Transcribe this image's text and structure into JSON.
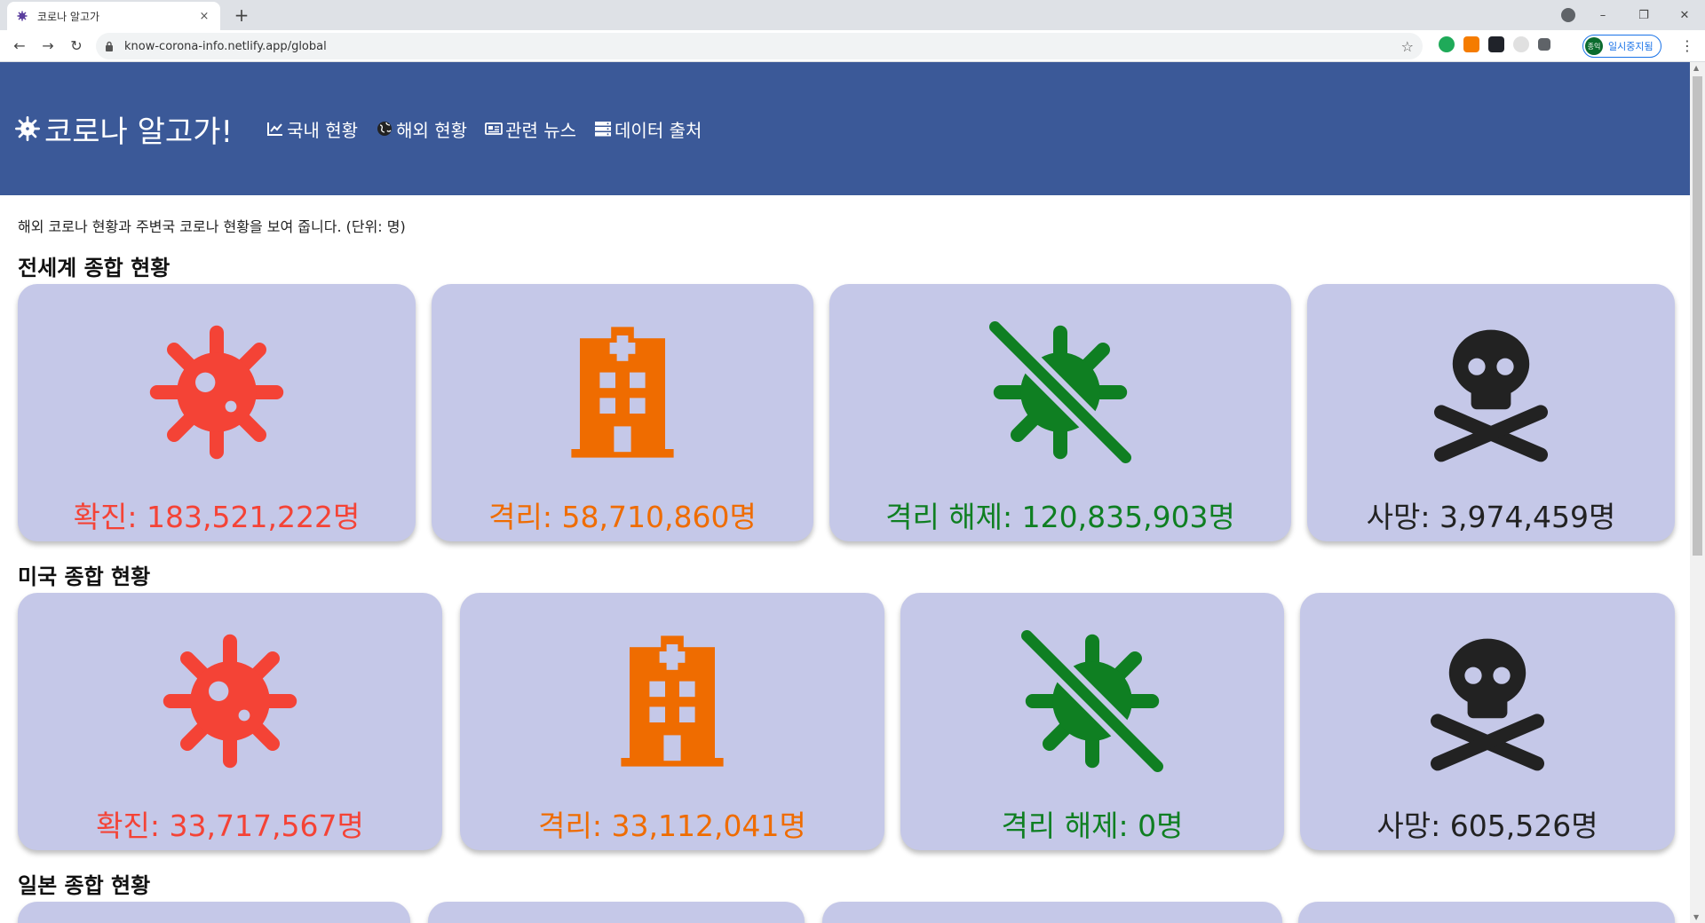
{
  "browser": {
    "tab_title": "코로나 알고가",
    "tab_close": "×",
    "new_tab": "+",
    "url": "know-corona-info.netlify.app/global",
    "paused_label": "일시중지됨",
    "avatar_text": "종익",
    "window_min": "–",
    "window_restore": "❐",
    "window_close": "✕",
    "back": "←",
    "forward": "→",
    "reload": "↻",
    "star": "☆",
    "menu": "⋮"
  },
  "header": {
    "brand": "코로나 알고가!",
    "nav": [
      {
        "label": "국내 현황",
        "icon": "chart-line-icon"
      },
      {
        "label": "해외 현황",
        "icon": "globe-icon"
      },
      {
        "label": "관련 뉴스",
        "icon": "newspaper-icon"
      },
      {
        "label": "데이터 출처",
        "icon": "server-icon"
      }
    ]
  },
  "intro": "해외 코로나 현황과 주변국 코로나 현황을 보여 줍니다. (단위: 명)",
  "sections": [
    {
      "title": "전세계 종합 현황",
      "cards": [
        {
          "label": "확진: 183,521,222명",
          "icon": "virus-icon",
          "color": "#f44336"
        },
        {
          "label": "격리: 58,710,860명",
          "icon": "hospital-icon",
          "color": "#ef6c00"
        },
        {
          "label": "격리 해제: 120,835,903명",
          "icon": "virus-slash-icon",
          "color": "#0f7f22"
        },
        {
          "label": "사망: 3,974,459명",
          "icon": "skull-crossbones-icon",
          "color": "#222222"
        }
      ]
    },
    {
      "title": "미국 종합 현황",
      "cards": [
        {
          "label": "확진: 33,717,567명",
          "icon": "virus-icon",
          "color": "#f44336"
        },
        {
          "label": "격리: 33,112,041명",
          "icon": "hospital-icon",
          "color": "#ef6c00"
        },
        {
          "label": "격리 해제: 0명",
          "icon": "virus-slash-icon",
          "color": "#0f7f22"
        },
        {
          "label": "사망: 605,526명",
          "icon": "skull-crossbones-icon",
          "color": "#222222"
        }
      ]
    },
    {
      "title": "일본 종합 현황"
    }
  ]
}
